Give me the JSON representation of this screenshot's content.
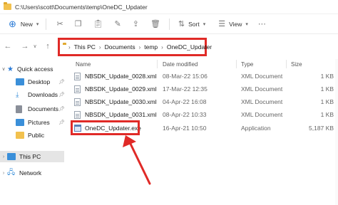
{
  "window": {
    "title": "C:\\Users\\scott\\Documents\\temp\\OneDC_Updater"
  },
  "toolbar": {
    "new_label": "New",
    "sort_label": "Sort",
    "view_label": "View",
    "icons": [
      "new-icon",
      "cut-icon",
      "copy-icon",
      "paste-icon",
      "rename-icon",
      "share-icon",
      "delete-icon",
      "sort-icon",
      "view-icon",
      "more-icon"
    ]
  },
  "address": {
    "crumbs": [
      "This PC",
      "Documents",
      "temp",
      "OneDC_Updater"
    ]
  },
  "sidebar": {
    "items": [
      {
        "label": "Quick access",
        "icon": "star-icon",
        "color": "#2b7bd6"
      },
      {
        "label": "Desktop",
        "icon": "desktop-icon",
        "color": "#3a8fd9"
      },
      {
        "label": "Downloads",
        "icon": "download-icon",
        "color": "#3a8fd9"
      },
      {
        "label": "Documents",
        "icon": "document-icon",
        "color": "#8a8f99"
      },
      {
        "label": "Pictures",
        "icon": "pictures-icon",
        "color": "#3a8fd9"
      },
      {
        "label": "Public",
        "icon": "folder-icon",
        "color": "#f2c14e"
      },
      {
        "label": "This PC",
        "icon": "pc-icon",
        "color": "#3a8fd9"
      },
      {
        "label": "Network",
        "icon": "network-icon",
        "color": "#3a8fd9"
      }
    ]
  },
  "columns": {
    "name": "Name",
    "date": "Date modified",
    "type": "Type",
    "size": "Size"
  },
  "files": [
    {
      "name": "NBSDK_Update_0028.xml",
      "date": "08-Mar-22 15:06",
      "type": "XML Document",
      "size": "1 KB"
    },
    {
      "name": "NBSDK_Update_0029.xml",
      "date": "17-Mar-22 12:35",
      "type": "XML Document",
      "size": "1 KB"
    },
    {
      "name": "NBSDK_Update_0030.xml",
      "date": "04-Apr-22 16:08",
      "type": "XML Document",
      "size": "1 KB"
    },
    {
      "name": "NBSDK_Update_0031.xml",
      "date": "08-Apr-22 10:33",
      "type": "XML Document",
      "size": "1 KB"
    },
    {
      "name": "OneDC_Updater.exe",
      "date": "16-Apr-21 10:50",
      "type": "Application",
      "size": "5,187 KB"
    }
  ],
  "colors": {
    "annotation": "#e02a27"
  }
}
